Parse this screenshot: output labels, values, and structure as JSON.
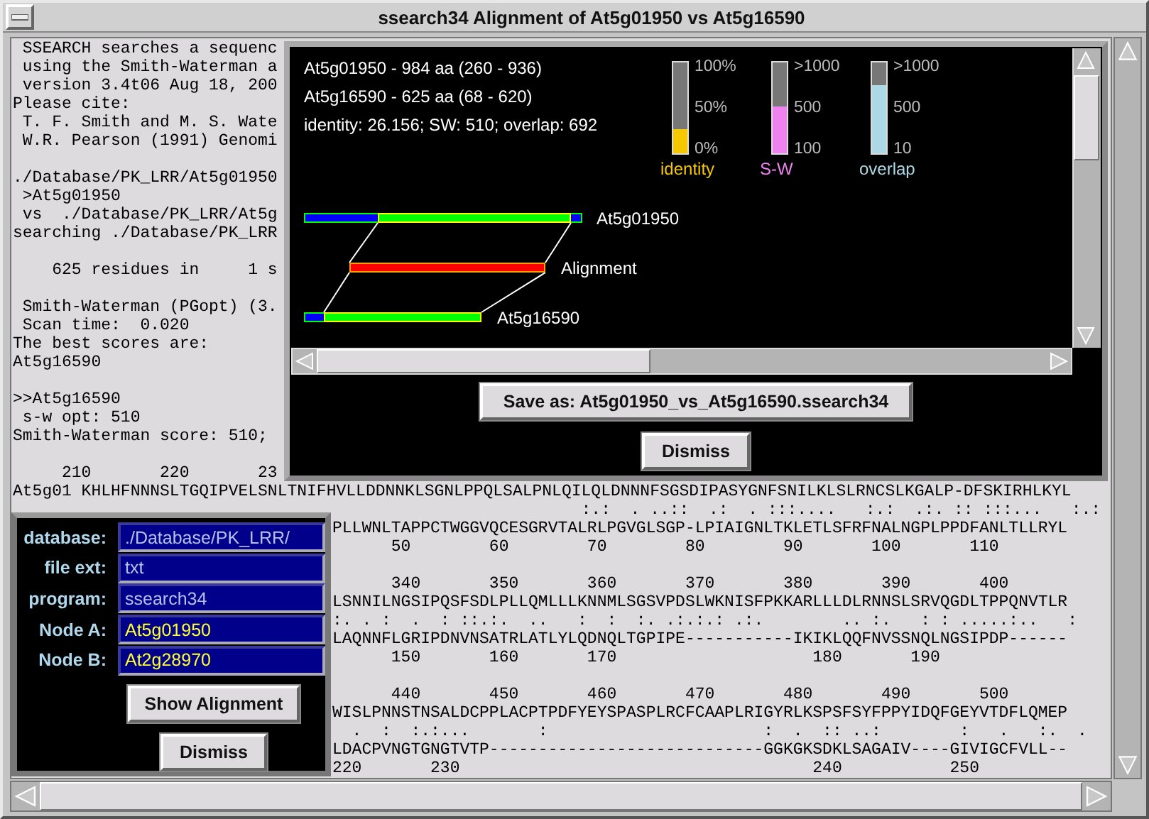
{
  "window": {
    "title": "ssearch34 Alignment of At5g01950 vs At5g16590"
  },
  "output": {
    "top_blocks": [
      [
        " SSEARCH searches a sequenc",
        " using the Smith-Waterman a",
        " version 3.4t06 Aug 18, 200",
        "Please cite:",
        " T. F. Smith and M. S. Wate",
        " W.R. Pearson (1991) Genomi"
      ],
      [
        "./Database/PK_LRR/At5g01950",
        " >At5g01950",
        " vs  ./Database/PK_LRR/At5g",
        "searching ./Database/PK_LRR"
      ],
      [
        "    625 residues in     1 s"
      ],
      [
        " Smith-Waterman (PGopt) (3.",
        " Scan time:  0.020",
        "The best scores are:",
        "At5g16590"
      ],
      [
        ">>At5g16590",
        " s-w opt: 510",
        "Smith-Waterman score: 510;"
      ],
      [
        "     210       220       23"
      ]
    ],
    "full_lines": [
      "At5g01 KHLHFNNNSLTGQIPVELSNLTNIFHVLLDDNNKLSGNLPPQLSALPNLQILQLDNNNFSGSDIPASYGNFSNILKLSLRNCSLKGALP-DFSKIRHLKYL",
      "                                                          :.:  . ..::  .:  . :::....   :.:  .:. :: :::...   :.:"
    ],
    "side_blocks": [
      [
        "PLLWNLTAPPCTWGGVQCESGRVTALRLPGVGLSGP-LPIAIGNLTKLETLSFRFNALNGPLPPDFANLTLLRYL",
        "      50        60        70        80        90       100       110"
      ],
      [
        "      340       350       360       370       380       390       400",
        "LSNNILNGSIPQSFSDLPLLQMLLLKNNMLSGSVPDSLWKNISFPKKARLLLDLRNNSLSRVQGDLTPPQNVTLR",
        ":. . :  .  : ::.:.  ..   :  :  :. .:.:.: .:.        .. :.   : : .....:..   :",
        "LAQNNFLGRIPDNVNSATRLATLYLQDNQLTGPIPE-----------IKIKLQQFNVSSNQLNGSIPDP------",
        "      150       160       170                    180       190"
      ],
      [
        "      440       450       460       470       480       490       500",
        "WISLPNNSTNSALDCPPLACPTPDFYEYSPASPLRCFCAAPLRIGYRLKSPSFSYFPPYIDQFGEYVTDFLQMEP",
        "  .  :  :.:...       :                      :  .  :: ..:        :   .   :.  .",
        "LDACPVNGTGNGTVTP----------------------------GGKGKSDKLSAGAIV----GIVIGCFVLL--",
        "220       230                                    240           250"
      ]
    ]
  },
  "alignment_window": {
    "info": [
      "At5g01950 - 984 aa (260 - 936)",
      "At5g16590 - 625 aa (68 - 620)",
      "identity: 26.156; SW: 510; overlap: 692"
    ],
    "legend": [
      {
        "label": "identity",
        "color": "#f5c800",
        "level": 0.26,
        "ticks": [
          "100%",
          "50%",
          "0%"
        ]
      },
      {
        "label": "S-W",
        "color": "#ee82ee",
        "level": 0.52,
        "ticks": [
          ">1000",
          "500",
          "100"
        ]
      },
      {
        "label": "overlap",
        "color": "#add8e6",
        "level": 0.75,
        "ticks": [
          ">1000",
          "500",
          "10"
        ]
      }
    ],
    "tracks": [
      {
        "label": "At5g01950",
        "kind": "sequence"
      },
      {
        "label": "Alignment",
        "kind": "alignment"
      },
      {
        "label": "At5g16590",
        "kind": "sequence"
      }
    ],
    "save_button": "Save as: At5g01950_vs_At5g16590.ssearch34",
    "dismiss_button": "Dismiss"
  },
  "settings_dialog": {
    "fields": [
      {
        "label": "database:",
        "value": "./Database/PK_LRR/",
        "kind": "setting"
      },
      {
        "label": "file ext:",
        "value": "txt",
        "kind": "setting"
      },
      {
        "label": "program:",
        "value": "ssearch34",
        "kind": "setting"
      },
      {
        "label": "Node A:",
        "value": "At5g01950",
        "kind": "node"
      },
      {
        "label": "Node B:",
        "value": "At2g28970",
        "kind": "node"
      }
    ],
    "buttons": [
      "Show Alignment",
      "Dismiss"
    ]
  }
}
